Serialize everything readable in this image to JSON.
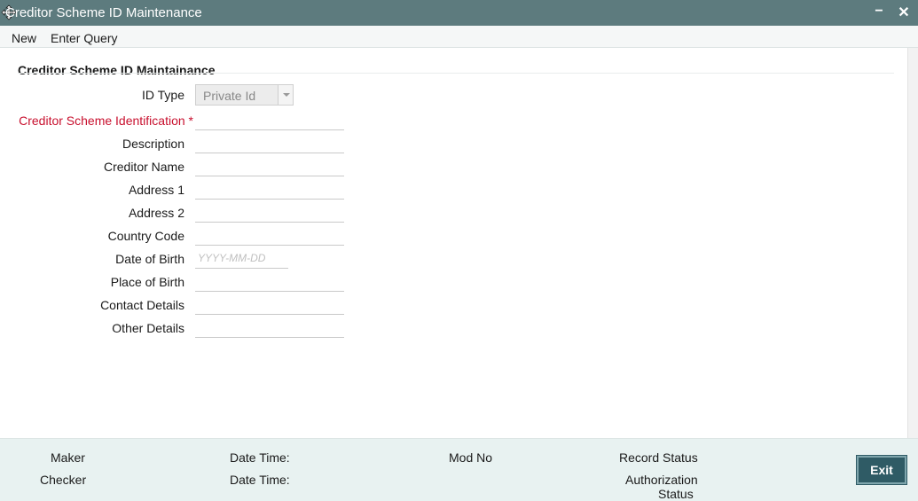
{
  "window": {
    "title": "Creditor Scheme ID Maintenance",
    "minimize_glyph": "−",
    "close_glyph": "✕"
  },
  "menu": {
    "new_label": "New",
    "enter_query_label": "Enter Query"
  },
  "form": {
    "section_title": "Creditor Scheme ID Maintainance",
    "id_type": {
      "label": "ID Type",
      "selected": "Private Id"
    },
    "creditor_scheme_identification": {
      "label": "Creditor Scheme Identification",
      "required_mark": "*",
      "value": ""
    },
    "description": {
      "label": "Description",
      "value": ""
    },
    "creditor_name": {
      "label": "Creditor Name",
      "value": ""
    },
    "address1": {
      "label": "Address 1",
      "value": ""
    },
    "address2": {
      "label": "Address 2",
      "value": ""
    },
    "country_code": {
      "label": "Country Code",
      "value": ""
    },
    "date_of_birth": {
      "label": "Date of Birth",
      "placeholder": "YYYY-MM-DD",
      "value": ""
    },
    "place_of_birth": {
      "label": "Place of Birth",
      "value": ""
    },
    "contact_details": {
      "label": "Contact Details",
      "value": ""
    },
    "other_details": {
      "label": "Other Details",
      "value": ""
    }
  },
  "footer": {
    "maker": "Maker",
    "checker": "Checker",
    "date_time_1": "Date Time:",
    "date_time_2": "Date Time:",
    "mod_no": "Mod No",
    "record_status": "Record Status",
    "authorization_status_line1": "Authorization",
    "authorization_status_line2": "Status",
    "exit_label": "Exit"
  }
}
